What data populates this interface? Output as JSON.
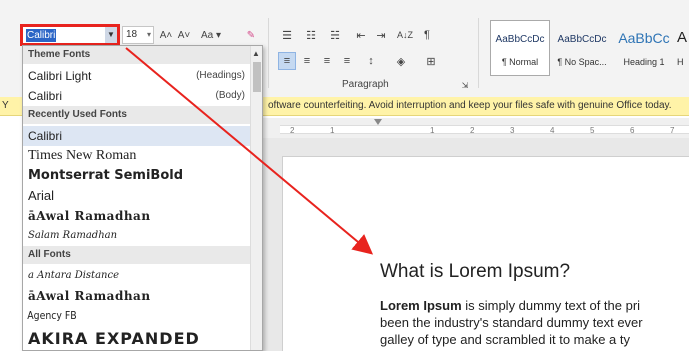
{
  "ribbon": {
    "font_name": "Calibri",
    "font_size": "18",
    "grow_font": "A˄",
    "shrink_font": "A˅",
    "change_case": "Aa",
    "paragraph_label": "Paragraph",
    "sort_glyph": "A↓Z",
    "pilcrow": "¶",
    "styles": [
      {
        "preview": "AaBbCcDc",
        "name": "¶ Normal"
      },
      {
        "preview": "AaBbCcDc",
        "name": "¶ No Spac..."
      },
      {
        "preview": "AaBbCc",
        "name": "Heading 1"
      },
      {
        "preview": "A",
        "name": "H"
      }
    ]
  },
  "notice": {
    "left_fragment": "Y",
    "text": "oftware counterfeiting. Avoid interruption and keep your files safe with genuine Office today."
  },
  "ruler": {
    "marks": [
      "2",
      "1",
      "1",
      "2",
      "3",
      "4",
      "5",
      "6",
      "7"
    ]
  },
  "document": {
    "heading": "What is Lorem Ipsum?",
    "line1_bold": "Lorem Ipsum",
    "line1_rest": " is simply dummy text of the pri",
    "line2": "been the industry's standard dummy text ever",
    "line3": "galley of type and scrambled it to make a ty"
  },
  "font_dropdown": {
    "theme_header": "Theme Fonts",
    "theme_items": [
      {
        "name": "Calibri Light",
        "role": "(Headings)"
      },
      {
        "name": "Calibri",
        "role": "(Body)"
      }
    ],
    "recent_header": "Recently Used Fonts",
    "recent_items": [
      "Calibri",
      "Times New Roman",
      "Montserrat SemiBold",
      "Arial",
      "āAwal Ramadhan",
      "Salam Ramadhan"
    ],
    "all_header": "All Fonts",
    "all_items": [
      "a Antara Distance",
      "āAwal Ramadhan",
      "Agency FB",
      "AKIRA EXPANDED"
    ]
  },
  "colors": {
    "highlight_box": "#e8231e",
    "arrow": "#e8231e",
    "selection": "#2b65c6",
    "notice_bg": "#fff3a8"
  }
}
